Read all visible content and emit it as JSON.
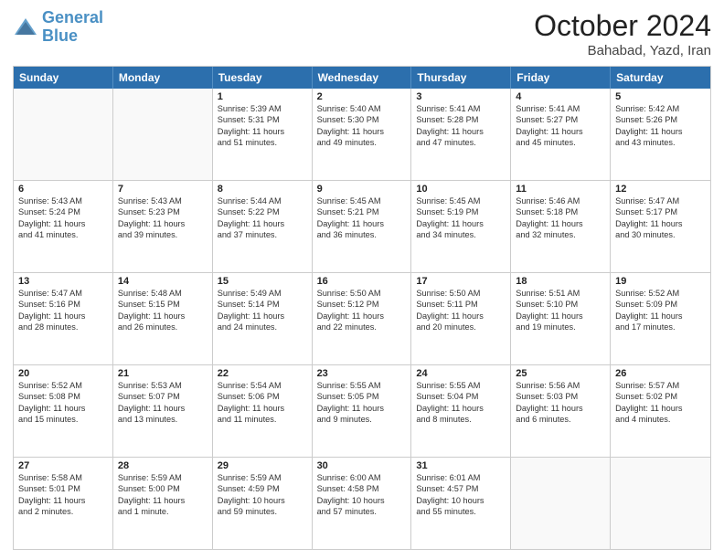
{
  "header": {
    "logo_line1": "General",
    "logo_line2": "Blue",
    "month": "October 2024",
    "location": "Bahabad, Yazd, Iran"
  },
  "weekdays": [
    "Sunday",
    "Monday",
    "Tuesday",
    "Wednesday",
    "Thursday",
    "Friday",
    "Saturday"
  ],
  "rows": [
    [
      {
        "day": "",
        "lines": []
      },
      {
        "day": "",
        "lines": []
      },
      {
        "day": "1",
        "lines": [
          "Sunrise: 5:39 AM",
          "Sunset: 5:31 PM",
          "Daylight: 11 hours",
          "and 51 minutes."
        ]
      },
      {
        "day": "2",
        "lines": [
          "Sunrise: 5:40 AM",
          "Sunset: 5:30 PM",
          "Daylight: 11 hours",
          "and 49 minutes."
        ]
      },
      {
        "day": "3",
        "lines": [
          "Sunrise: 5:41 AM",
          "Sunset: 5:28 PM",
          "Daylight: 11 hours",
          "and 47 minutes."
        ]
      },
      {
        "day": "4",
        "lines": [
          "Sunrise: 5:41 AM",
          "Sunset: 5:27 PM",
          "Daylight: 11 hours",
          "and 45 minutes."
        ]
      },
      {
        "day": "5",
        "lines": [
          "Sunrise: 5:42 AM",
          "Sunset: 5:26 PM",
          "Daylight: 11 hours",
          "and 43 minutes."
        ]
      }
    ],
    [
      {
        "day": "6",
        "lines": [
          "Sunrise: 5:43 AM",
          "Sunset: 5:24 PM",
          "Daylight: 11 hours",
          "and 41 minutes."
        ]
      },
      {
        "day": "7",
        "lines": [
          "Sunrise: 5:43 AM",
          "Sunset: 5:23 PM",
          "Daylight: 11 hours",
          "and 39 minutes."
        ]
      },
      {
        "day": "8",
        "lines": [
          "Sunrise: 5:44 AM",
          "Sunset: 5:22 PM",
          "Daylight: 11 hours",
          "and 37 minutes."
        ]
      },
      {
        "day": "9",
        "lines": [
          "Sunrise: 5:45 AM",
          "Sunset: 5:21 PM",
          "Daylight: 11 hours",
          "and 36 minutes."
        ]
      },
      {
        "day": "10",
        "lines": [
          "Sunrise: 5:45 AM",
          "Sunset: 5:19 PM",
          "Daylight: 11 hours",
          "and 34 minutes."
        ]
      },
      {
        "day": "11",
        "lines": [
          "Sunrise: 5:46 AM",
          "Sunset: 5:18 PM",
          "Daylight: 11 hours",
          "and 32 minutes."
        ]
      },
      {
        "day": "12",
        "lines": [
          "Sunrise: 5:47 AM",
          "Sunset: 5:17 PM",
          "Daylight: 11 hours",
          "and 30 minutes."
        ]
      }
    ],
    [
      {
        "day": "13",
        "lines": [
          "Sunrise: 5:47 AM",
          "Sunset: 5:16 PM",
          "Daylight: 11 hours",
          "and 28 minutes."
        ]
      },
      {
        "day": "14",
        "lines": [
          "Sunrise: 5:48 AM",
          "Sunset: 5:15 PM",
          "Daylight: 11 hours",
          "and 26 minutes."
        ]
      },
      {
        "day": "15",
        "lines": [
          "Sunrise: 5:49 AM",
          "Sunset: 5:14 PM",
          "Daylight: 11 hours",
          "and 24 minutes."
        ]
      },
      {
        "day": "16",
        "lines": [
          "Sunrise: 5:50 AM",
          "Sunset: 5:12 PM",
          "Daylight: 11 hours",
          "and 22 minutes."
        ]
      },
      {
        "day": "17",
        "lines": [
          "Sunrise: 5:50 AM",
          "Sunset: 5:11 PM",
          "Daylight: 11 hours",
          "and 20 minutes."
        ]
      },
      {
        "day": "18",
        "lines": [
          "Sunrise: 5:51 AM",
          "Sunset: 5:10 PM",
          "Daylight: 11 hours",
          "and 19 minutes."
        ]
      },
      {
        "day": "19",
        "lines": [
          "Sunrise: 5:52 AM",
          "Sunset: 5:09 PM",
          "Daylight: 11 hours",
          "and 17 minutes."
        ]
      }
    ],
    [
      {
        "day": "20",
        "lines": [
          "Sunrise: 5:52 AM",
          "Sunset: 5:08 PM",
          "Daylight: 11 hours",
          "and 15 minutes."
        ]
      },
      {
        "day": "21",
        "lines": [
          "Sunrise: 5:53 AM",
          "Sunset: 5:07 PM",
          "Daylight: 11 hours",
          "and 13 minutes."
        ]
      },
      {
        "day": "22",
        "lines": [
          "Sunrise: 5:54 AM",
          "Sunset: 5:06 PM",
          "Daylight: 11 hours",
          "and 11 minutes."
        ]
      },
      {
        "day": "23",
        "lines": [
          "Sunrise: 5:55 AM",
          "Sunset: 5:05 PM",
          "Daylight: 11 hours",
          "and 9 minutes."
        ]
      },
      {
        "day": "24",
        "lines": [
          "Sunrise: 5:55 AM",
          "Sunset: 5:04 PM",
          "Daylight: 11 hours",
          "and 8 minutes."
        ]
      },
      {
        "day": "25",
        "lines": [
          "Sunrise: 5:56 AM",
          "Sunset: 5:03 PM",
          "Daylight: 11 hours",
          "and 6 minutes."
        ]
      },
      {
        "day": "26",
        "lines": [
          "Sunrise: 5:57 AM",
          "Sunset: 5:02 PM",
          "Daylight: 11 hours",
          "and 4 minutes."
        ]
      }
    ],
    [
      {
        "day": "27",
        "lines": [
          "Sunrise: 5:58 AM",
          "Sunset: 5:01 PM",
          "Daylight: 11 hours",
          "and 2 minutes."
        ]
      },
      {
        "day": "28",
        "lines": [
          "Sunrise: 5:59 AM",
          "Sunset: 5:00 PM",
          "Daylight: 11 hours",
          "and 1 minute."
        ]
      },
      {
        "day": "29",
        "lines": [
          "Sunrise: 5:59 AM",
          "Sunset: 4:59 PM",
          "Daylight: 10 hours",
          "and 59 minutes."
        ]
      },
      {
        "day": "30",
        "lines": [
          "Sunrise: 6:00 AM",
          "Sunset: 4:58 PM",
          "Daylight: 10 hours",
          "and 57 minutes."
        ]
      },
      {
        "day": "31",
        "lines": [
          "Sunrise: 6:01 AM",
          "Sunset: 4:57 PM",
          "Daylight: 10 hours",
          "and 55 minutes."
        ]
      },
      {
        "day": "",
        "lines": []
      },
      {
        "day": "",
        "lines": []
      }
    ]
  ]
}
